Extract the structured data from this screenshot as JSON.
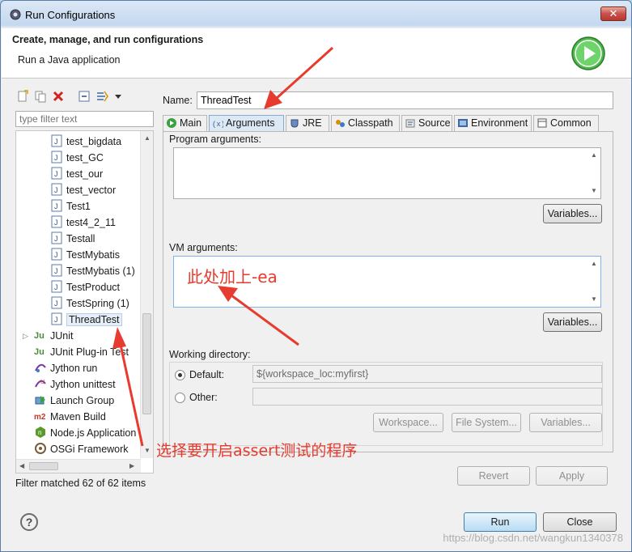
{
  "window": {
    "title": "Run Configurations",
    "close_glyph": "✕"
  },
  "header": {
    "title": "Create, manage, and run configurations",
    "subtitle": "Run a Java application",
    "icon": "run-icon"
  },
  "left": {
    "filter_placeholder": "type filter text",
    "tree": [
      {
        "label": "test_bigdata",
        "icon": "java-app-icon"
      },
      {
        "label": "test_GC",
        "icon": "java-app-icon"
      },
      {
        "label": "test_our",
        "icon": "java-app-icon"
      },
      {
        "label": "test_vector",
        "icon": "java-app-icon"
      },
      {
        "label": "Test1",
        "icon": "java-app-icon"
      },
      {
        "label": "test4_2_11",
        "icon": "java-app-icon"
      },
      {
        "label": "Testall",
        "icon": "java-app-icon"
      },
      {
        "label": "TestMybatis",
        "icon": "java-app-icon"
      },
      {
        "label": "TestMybatis (1)",
        "icon": "java-app-icon"
      },
      {
        "label": "TestProduct",
        "icon": "java-app-icon"
      },
      {
        "label": "TestSpring (1)",
        "icon": "java-app-icon"
      },
      {
        "label": "ThreadTest",
        "icon": "java-app-icon",
        "selected": true
      },
      {
        "label": "JUnit",
        "icon": "junit-icon",
        "expandable": true
      },
      {
        "label": "JUnit Plug-in Test",
        "icon": "junit-plugin-icon"
      },
      {
        "label": "Jython run",
        "icon": "jython-icon"
      },
      {
        "label": "Jython unittest",
        "icon": "jython-unittest-icon"
      },
      {
        "label": "Launch Group",
        "icon": "launch-group-icon"
      },
      {
        "label": "Maven Build",
        "icon": "maven-icon"
      },
      {
        "label": "Node.js Application",
        "icon": "nodejs-icon"
      },
      {
        "label": "OSGi Framework",
        "icon": "osgi-icon"
      }
    ],
    "matched": "Filter matched 62 of 62 items"
  },
  "config": {
    "name_label": "Name:",
    "name_value": "ThreadTest",
    "tabs": [
      {
        "label": "Main",
        "icon": "main-tab-icon"
      },
      {
        "label": "Arguments",
        "icon": "arguments-tab-icon",
        "active": true
      },
      {
        "label": "JRE",
        "icon": "jre-tab-icon"
      },
      {
        "label": "Classpath",
        "icon": "classpath-tab-icon"
      },
      {
        "label": "Source",
        "icon": "source-tab-icon"
      },
      {
        "label": "Environment",
        "icon": "environment-tab-icon"
      },
      {
        "label": "Common",
        "icon": "common-tab-icon"
      }
    ],
    "program_args_label": "Program arguments:",
    "program_args_value": "",
    "variables_label": "Variables...",
    "vm_args_label": "VM arguments:",
    "vm_args_value": "",
    "working_dir_label": "Working directory:",
    "default_label": "Default:",
    "default_value": "${workspace_loc:myfirst}",
    "other_label": "Other:",
    "other_value": "",
    "workspace_btn": "Workspace...",
    "filesystem_btn": "File System...",
    "variables_btn2": "Variables..."
  },
  "footer": {
    "revert": "Revert",
    "apply": "Apply",
    "run": "Run",
    "close": "Close",
    "help_glyph": "?"
  },
  "annotations": {
    "vm_note": "此处加上-ea",
    "select_note": "选择要开启assert测试的程序",
    "color": "#e63b2e"
  },
  "watermark": "https://blog.csdn.net/wangkun1340378"
}
